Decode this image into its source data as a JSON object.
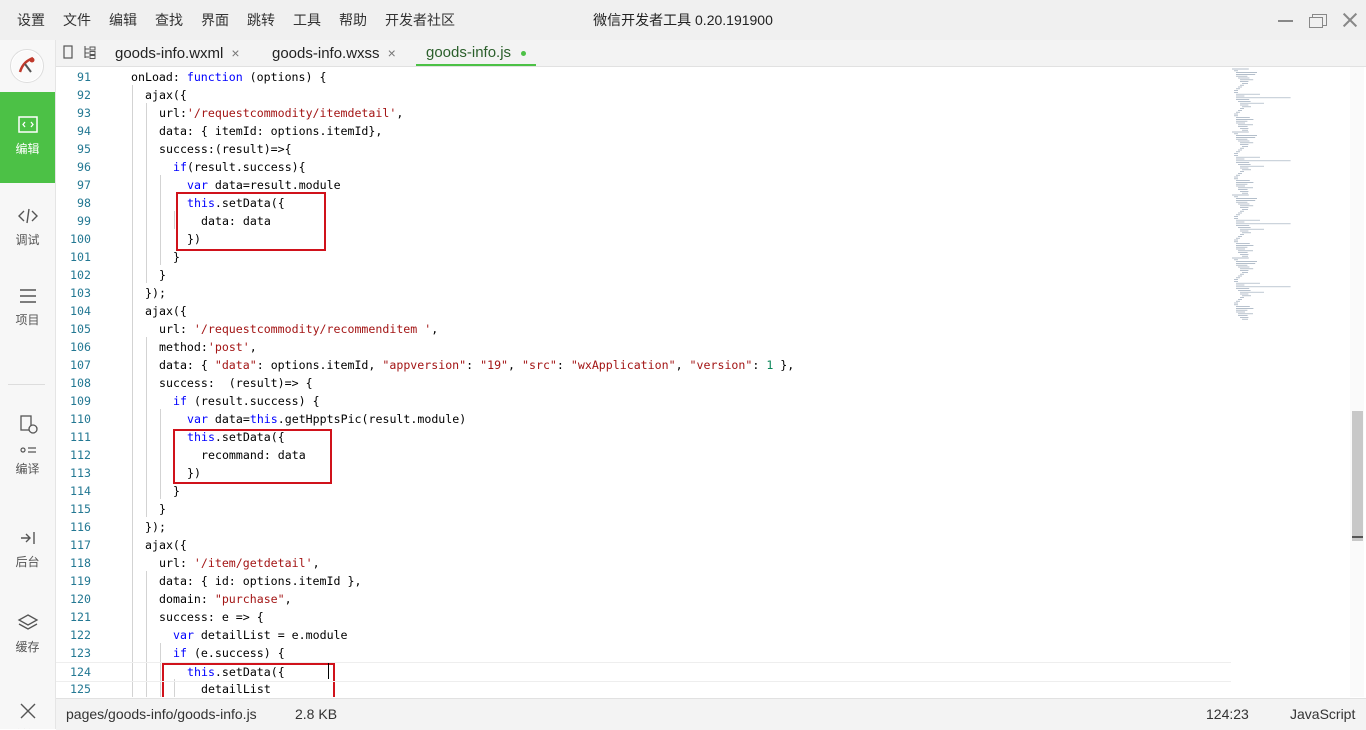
{
  "titlebar": {
    "title": "微信开发者工具 0.20.191900",
    "menu": [
      "设置",
      "文件",
      "编辑",
      "查找",
      "界面",
      "跳转",
      "工具",
      "帮助",
      "开发者社区"
    ]
  },
  "sidebar": {
    "items": [
      {
        "label": "编辑",
        "icon": "code-editor-icon",
        "active": true
      },
      {
        "label": "调试",
        "icon": "debug-code-icon"
      },
      {
        "label": "项目",
        "icon": "project-list-icon"
      },
      {
        "label": "编译",
        "icon": "compile-icon"
      },
      {
        "label": "后台",
        "icon": "backend-icon"
      },
      {
        "label": "缓存",
        "icon": "cache-layers-icon"
      },
      {
        "label": "关闭",
        "icon": "close-icon"
      }
    ]
  },
  "tabs": [
    {
      "label": "goods-info.wxml",
      "close": "×"
    },
    {
      "label": "goods-info.wxss",
      "close": "×"
    },
    {
      "label": "goods-info.js",
      "active": true
    }
  ],
  "editor": {
    "lines": [
      {
        "n": "91",
        "i": 0,
        "t": "onLoad: function (options) {"
      },
      {
        "n": "92",
        "i": 1,
        "t": "ajax({"
      },
      {
        "n": "93",
        "i": 2,
        "t": "url:'/requestcommodity/itemdetail',"
      },
      {
        "n": "94",
        "i": 2,
        "t": "data: { itemId: options.itemId},"
      },
      {
        "n": "95",
        "i": 2,
        "t": "success:(result)=>{"
      },
      {
        "n": "96",
        "i": 3,
        "t": "if(result.success){"
      },
      {
        "n": "97",
        "i": 4,
        "t": "var data=result.module"
      },
      {
        "n": "98",
        "i": 4,
        "t": "this.setData({"
      },
      {
        "n": "99",
        "i": 5,
        "t": "data: data"
      },
      {
        "n": "100",
        "i": 4,
        "t": "})"
      },
      {
        "n": "101",
        "i": 3,
        "t": "}"
      },
      {
        "n": "102",
        "i": 2,
        "t": "}"
      },
      {
        "n": "103",
        "i": 1,
        "t": "});"
      },
      {
        "n": "104",
        "i": 1,
        "t": "ajax({"
      },
      {
        "n": "105",
        "i": 2,
        "t": "url: '/requestcommodity/recommenditem ',"
      },
      {
        "n": "106",
        "i": 2,
        "t": "method:'post',"
      },
      {
        "n": "107",
        "i": 2,
        "t": "data: { \"data\": options.itemId, \"appversion\": \"19\", \"src\": \"wxApplication\", \"version\": 1 },"
      },
      {
        "n": "108",
        "i": 2,
        "t": "success:  (result)=> {"
      },
      {
        "n": "109",
        "i": 3,
        "t": "if (result.success) {"
      },
      {
        "n": "110",
        "i": 4,
        "t": "var data=this.getHpptsPic(result.module)"
      },
      {
        "n": "111",
        "i": 4,
        "t": "this.setData({"
      },
      {
        "n": "112",
        "i": 5,
        "t": "recommand: data"
      },
      {
        "n": "113",
        "i": 4,
        "t": "})"
      },
      {
        "n": "114",
        "i": 3,
        "t": "}"
      },
      {
        "n": "115",
        "i": 2,
        "t": "}"
      },
      {
        "n": "116",
        "i": 1,
        "t": "});"
      },
      {
        "n": "117",
        "i": 1,
        "t": "ajax({"
      },
      {
        "n": "118",
        "i": 2,
        "t": "url: '/item/getdetail',"
      },
      {
        "n": "119",
        "i": 2,
        "t": "data: { id: options.itemId },"
      },
      {
        "n": "120",
        "i": 2,
        "t": "domain: \"purchase\","
      },
      {
        "n": "121",
        "i": 2,
        "t": "success: e => {"
      },
      {
        "n": "122",
        "i": 3,
        "t": "var detailList = e.module"
      },
      {
        "n": "123",
        "i": 3,
        "t": "if (e.success) {"
      },
      {
        "n": "124",
        "i": 4,
        "t": "this.setData({"
      },
      {
        "n": "125",
        "i": 5,
        "t": "detailList"
      }
    ],
    "current_line": "124"
  },
  "statusbar": {
    "path": "pages/goods-info/goods-info.js",
    "size": "2.8 KB",
    "cursor": "124:23",
    "language": "JavaScript"
  }
}
